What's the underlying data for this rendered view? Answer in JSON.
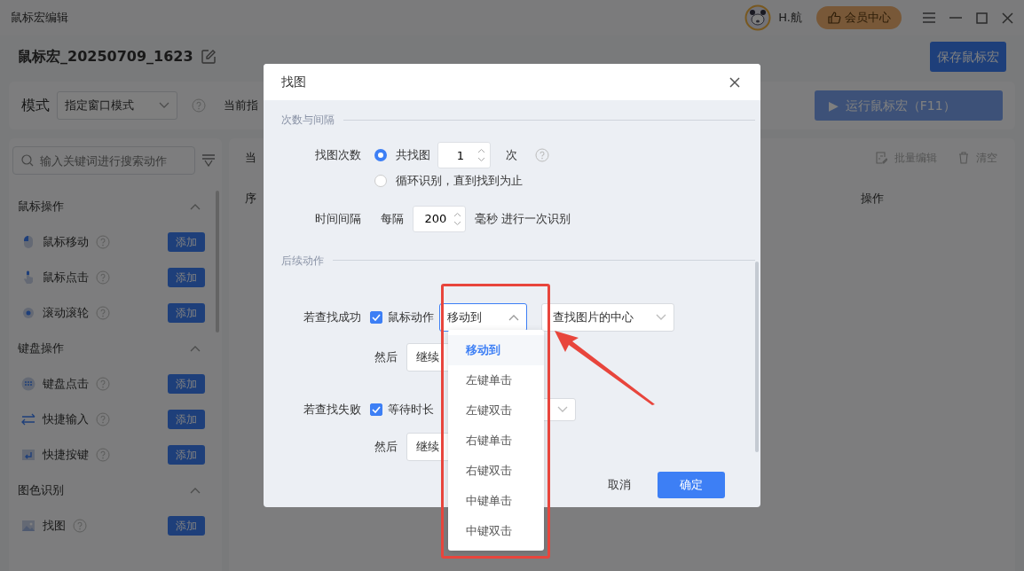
{
  "window": {
    "title": "鼠标宏编辑",
    "user": "H.航",
    "member_button": "会员中心"
  },
  "macro": {
    "name": "鼠标宏_20250709_1623",
    "save_button": "保存鼠标宏"
  },
  "toolbar": {
    "mode_label": "模式",
    "mode_value": "指定窗口模式",
    "current_label": "当前指",
    "run_icon": "▶",
    "run_button": "运行鼠标宏（F11）",
    "run_disabled": true
  },
  "sidebar": {
    "search_placeholder": "输入关键词进行搜索动作",
    "groups": [
      {
        "title": "鼠标操作",
        "expanded": true,
        "items": [
          {
            "label": "鼠标移动",
            "add": "添加"
          },
          {
            "label": "鼠标点击",
            "add": "添加"
          },
          {
            "label": "滚动滚轮",
            "add": "添加"
          }
        ]
      },
      {
        "title": "键盘操作",
        "expanded": true,
        "items": [
          {
            "label": "键盘点击",
            "add": "添加"
          },
          {
            "label": "快捷输入",
            "add": "添加"
          },
          {
            "label": "快捷按键",
            "add": "添加"
          }
        ]
      },
      {
        "title": "图色识别",
        "expanded": true,
        "items": [
          {
            "label": "找图",
            "add": "添加"
          }
        ]
      }
    ]
  },
  "content": {
    "current_label": "当",
    "batch_edit": "批量编辑",
    "clear": "清空",
    "columns": [
      "序",
      "操作"
    ]
  },
  "dialog": {
    "title": "找图",
    "section_1": "次数与间隔",
    "count_label": "找图次数",
    "count_options": [
      {
        "label": "共找图",
        "selected": true,
        "value": "1",
        "unit": "次"
      },
      {
        "label": "循环识别，直到找到为止",
        "selected": false
      }
    ],
    "interval_label": "时间间隔",
    "interval_prefix": "每隔",
    "interval_value": "200",
    "interval_suffix": "毫秒 进行一次识别",
    "section_2": "后续动作",
    "on_success": {
      "label": "若查找成功",
      "checkbox": "鼠标动作",
      "checked": true,
      "action": "移动到",
      "action_open": true,
      "target": "查找图片的中心",
      "then_label": "然后",
      "then_value": "继续"
    },
    "on_fail": {
      "label": "若查找失败",
      "checkbox": "等待时长",
      "checked": true,
      "then_label": "然后",
      "then_value": "继续"
    },
    "cancel": "取消",
    "ok": "确定"
  },
  "dropdown": {
    "options": [
      {
        "label": "移动到",
        "selected": true
      },
      {
        "label": "左键单击",
        "selected": false
      },
      {
        "label": "左键双击",
        "selected": false
      },
      {
        "label": "右键单击",
        "selected": false
      },
      {
        "label": "右键双击",
        "selected": false
      },
      {
        "label": "中键单击",
        "selected": false
      },
      {
        "label": "中键双击",
        "selected": false
      }
    ]
  }
}
